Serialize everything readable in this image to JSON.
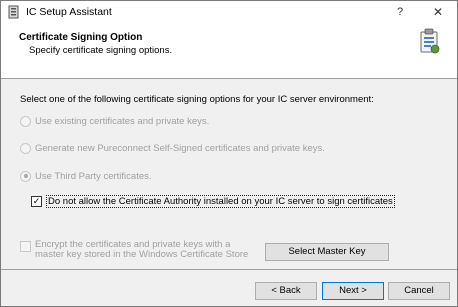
{
  "window": {
    "title": "IC Setup Assistant",
    "help_glyph": "?",
    "close_glyph": "✕",
    "app_icon": "setup-assistant-icon"
  },
  "header": {
    "title": "Certificate Signing Option",
    "subtitle": "Specify certificate signing options.",
    "icon": "clipboard-install-icon"
  },
  "content": {
    "instruction": "Select one of the following certificate signing options for your IC server environment:",
    "options": [
      {
        "label": "Use existing certificates and private keys.",
        "selected": false,
        "enabled": false
      },
      {
        "label": "Generate new Pureconnect Self-Signed certificates and private keys.",
        "selected": false,
        "enabled": false
      },
      {
        "label": "Use Third Party certificates.",
        "selected": true,
        "enabled": false
      }
    ],
    "ca_checkbox": {
      "label": "Do not allow the Certificate Authority installed on your IC server to sign certificates",
      "checked": true,
      "check_glyph": "✓"
    },
    "encrypt_checkbox": {
      "label": "Encrypt the certificates and private keys with a master key stored in the Windows Certificate Store",
      "checked": false,
      "enabled": false
    },
    "master_key_button": "Select Master Key"
  },
  "footer": {
    "back_label": "< Back",
    "next_label": "Next >",
    "cancel_label": "Cancel"
  },
  "colors": {
    "disabled_text": "#a0a0a0",
    "default_button_border": "#0078d7",
    "dialog_bg": "#f0f0f0"
  }
}
